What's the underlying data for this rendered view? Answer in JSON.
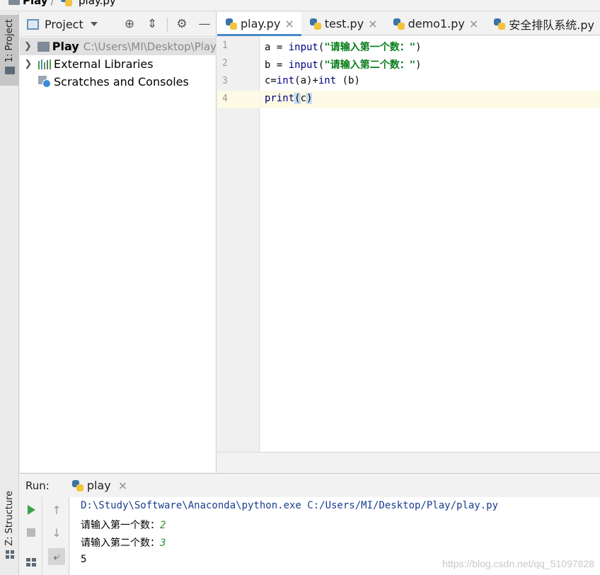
{
  "breadcrumb": {
    "project": "Play",
    "file": "play.py"
  },
  "left_strip": {
    "project_tab": "1: Project",
    "structure_tab": "Z: Structure"
  },
  "project_panel": {
    "title": "Project",
    "icons": [
      "locate-icon",
      "collapse-icon",
      "gear-icon",
      "minimize-icon"
    ],
    "tree": [
      {
        "label": "Play",
        "hint": "C:\\Users\\MI\\Desktop\\Play"
      },
      {
        "label": "External Libraries"
      },
      {
        "label": "Scratches and Consoles"
      }
    ]
  },
  "editor": {
    "tabs": [
      {
        "label": "play.py",
        "active": true
      },
      {
        "label": "test.py"
      },
      {
        "label": "demo1.py"
      },
      {
        "label": "安全排队系统.py"
      }
    ],
    "line_numbers": [
      "1",
      "2",
      "3",
      "4"
    ],
    "code": {
      "l1_var": "a = ",
      "l1_fn": "input",
      "l1_open": "(",
      "l1_str": "\"请输入第一个数：\"",
      "l1_close": ")",
      "l2_var": "b = ",
      "l2_fn": "input",
      "l2_open": "(",
      "l2_str": "\"请输入第二个数：\"",
      "l2_close": ")",
      "l3_a": "c=",
      "l3_int1": "int",
      "l3_b": "(a)+",
      "l3_int2": "int",
      "l3_c": " (b)",
      "l4_fn": "print",
      "l4_open": "(",
      "l4_arg": "c",
      "l4_close": ")"
    }
  },
  "run": {
    "label": "Run:",
    "tab": "play",
    "console": {
      "command": "D:\\Study\\Software\\Anaconda\\python.exe C:/Users/MI/Desktop/Play/play.py",
      "prompt1": "请输入第一个数：",
      "input1": "2",
      "prompt2": "请输入第二个数：",
      "input2": "3",
      "output": "5"
    }
  },
  "watermark": "https://blog.csdn.net/qq_51097828",
  "colors": {
    "accent": "#4a88c7",
    "caret_line": "#fdfbe5",
    "keyword": "#000080",
    "string": "#067d17",
    "run_green": "#3aa24a"
  }
}
